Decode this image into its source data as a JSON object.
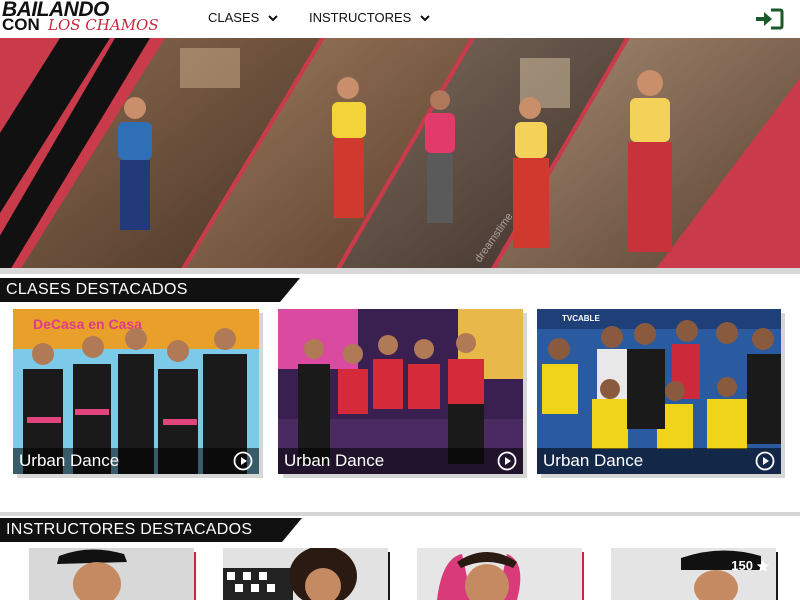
{
  "header": {
    "logo_line1": "BAILANDO",
    "logo_line2": "CON",
    "logo_line3": "LOS CHAMOS",
    "nav": [
      {
        "label": "CLASES",
        "icon": "chevron-down-icon"
      },
      {
        "label": "INSTRUCTORES",
        "icon": "chevron-down-icon"
      }
    ],
    "login_icon": "sign-in-icon"
  },
  "hero": {
    "watermarks": [
      "dreamstime"
    ]
  },
  "sections": {
    "classes_title": "CLASES DESTACADOS",
    "instructors_title": "INSTRUCTORES DESTACADOS"
  },
  "classes": [
    {
      "caption": "Urban Dance",
      "icon": "play-icon",
      "sign_text": "DeCasa en Casa"
    },
    {
      "caption": "Urban Dance",
      "icon": "play-icon",
      "sign_text": ""
    },
    {
      "caption": "Urban Dance",
      "icon": "play-icon",
      "sign_text": "TVCABLE"
    }
  ],
  "instructors": [
    {
      "name": "",
      "badge": ""
    },
    {
      "name": "",
      "badge": ""
    },
    {
      "name": "",
      "badge": ""
    },
    {
      "name": "",
      "badge": "150"
    }
  ],
  "colors": {
    "accent_red": "#c8283c",
    "banner_black": "#111111",
    "rule_gray": "#d6d6d6"
  }
}
